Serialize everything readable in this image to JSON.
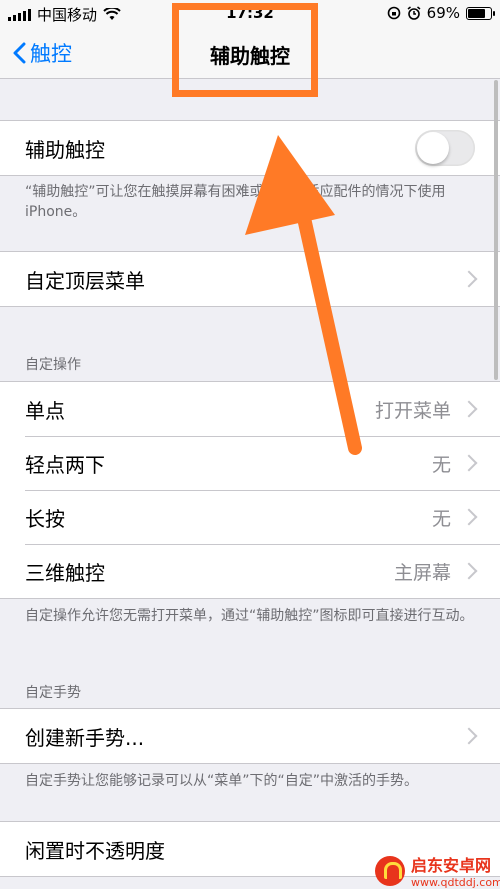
{
  "status_bar": {
    "carrier": "中国移动",
    "time": "17:32",
    "battery_percent": "69%",
    "battery_level": 0.69,
    "wifi_icon": "wifi-icon",
    "alarm_icon": "alarm-icon",
    "rotation_lock_icon": "rotation-lock-icon"
  },
  "nav": {
    "back_label": "触控",
    "title": "辅助触控"
  },
  "main_toggle": {
    "label": "辅助触控",
    "enabled": false,
    "note": "“辅助触控”可让您在触摸屏幕有困难或需要自适应配件的情况下使用 iPhone。"
  },
  "top_menu": {
    "label": "自定顶层菜单"
  },
  "custom_actions": {
    "header": "自定操作",
    "items": [
      {
        "label": "单点",
        "value": "打开菜单"
      },
      {
        "label": "轻点两下",
        "value": "无"
      },
      {
        "label": "长按",
        "value": "无"
      },
      {
        "label": "三维触控",
        "value": "主屏幕"
      }
    ],
    "note": "自定操作允许您无需打开菜单，通过“辅助触控”图标即可直接进行互动。"
  },
  "custom_gestures": {
    "header": "自定手势",
    "create_label": "创建新手势...",
    "note": "自定手势让您能够记录可以从“菜单”下的“自定”中激活的手势。"
  },
  "idle_opacity": {
    "label": "闲置时不透明度"
  },
  "watermark": {
    "name": "启东安卓网",
    "url": "www.qdtddj.com"
  },
  "colors": {
    "accent": "#007aff",
    "annotation": "#ff7a26"
  }
}
